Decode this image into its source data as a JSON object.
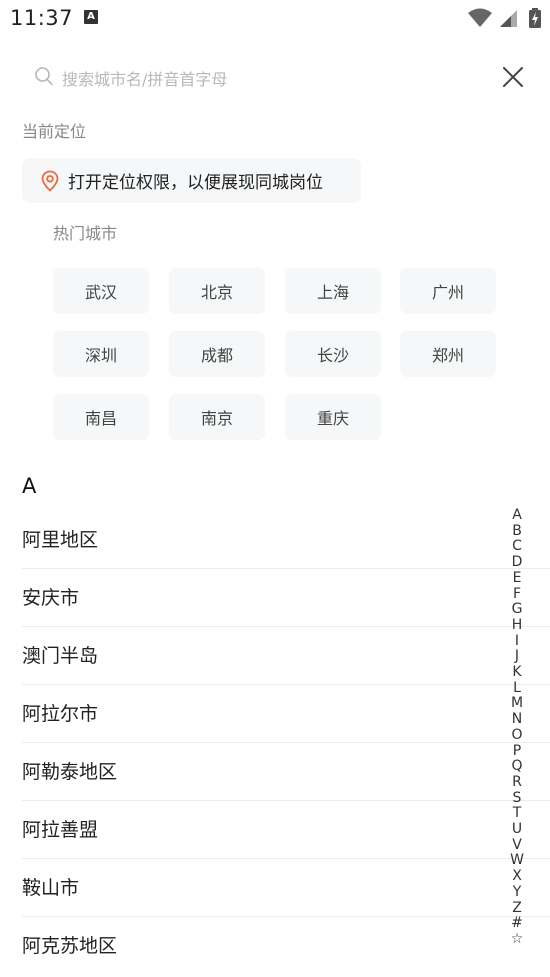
{
  "status_bar": {
    "time": "11:37",
    "notification_badge": "A",
    "icons": [
      "wifi-icon",
      "signal-icon",
      "battery-charging-icon"
    ]
  },
  "search": {
    "placeholder": "搜索城市名/拼音首字母",
    "value": "",
    "icon": "search-icon",
    "close_icon": "close-icon"
  },
  "current_location": {
    "label": "当前定位",
    "button_text": "打开定位权限，以便展现同城岗位",
    "icon": "location-pin-icon",
    "accent_color": "#f0663c"
  },
  "hot_cities": {
    "label": "热门城市",
    "items": [
      "武汉",
      "北京",
      "上海",
      "广州",
      "深圳",
      "成都",
      "长沙",
      "郑州",
      "南昌",
      "南京",
      "重庆"
    ]
  },
  "city_section": {
    "letter": "A",
    "cities": [
      "阿里地区",
      "安庆市",
      "澳门半岛",
      "阿拉尔市",
      "阿勒泰地区",
      "阿拉善盟",
      "鞍山市",
      "阿克苏地区"
    ]
  },
  "index_bar": {
    "letters": [
      "A",
      "B",
      "C",
      "D",
      "E",
      "F",
      "G",
      "H",
      "I",
      "J",
      "K",
      "L",
      "M",
      "N",
      "O",
      "P",
      "Q",
      "R",
      "S",
      "T",
      "U",
      "V",
      "W",
      "X",
      "Y",
      "Z",
      "#",
      "☆"
    ]
  }
}
